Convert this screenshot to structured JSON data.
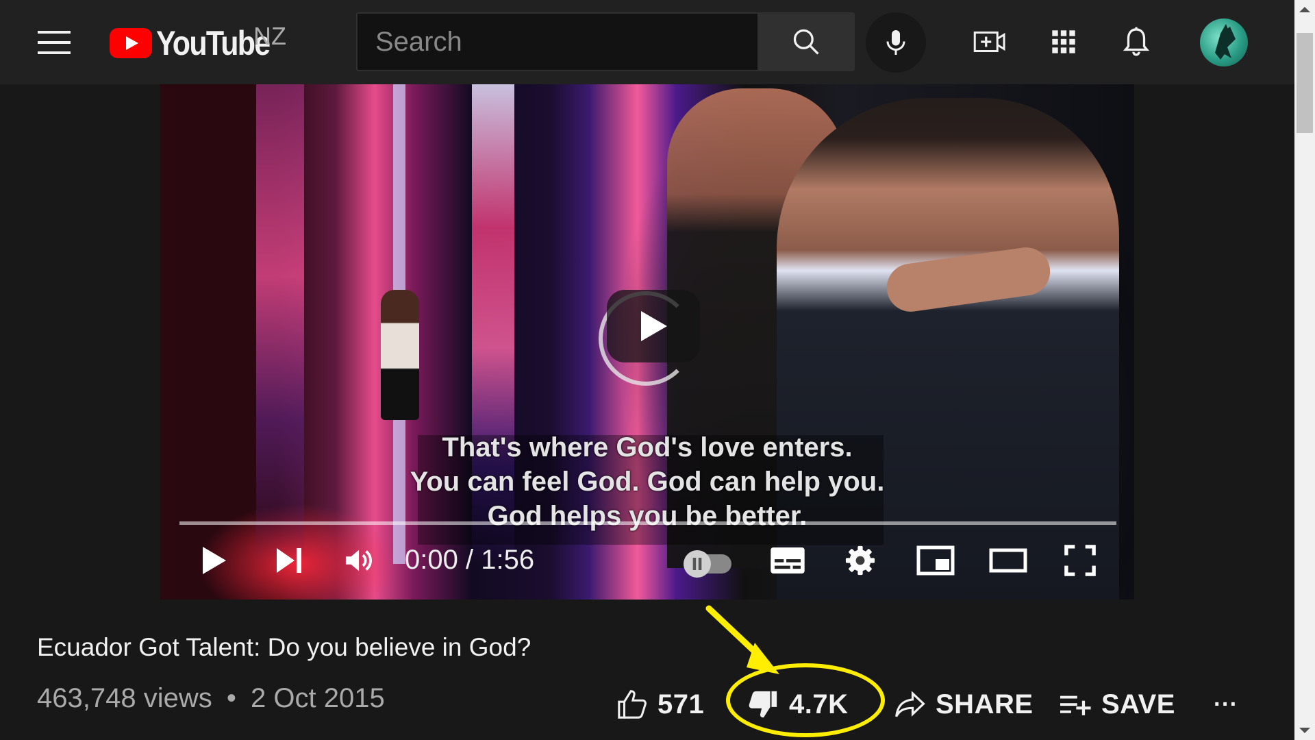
{
  "header": {
    "logo_text": "YouTube",
    "country_code": "NZ",
    "search_placeholder": "Search"
  },
  "icons": {
    "menu": "menu-icon",
    "search": "search-icon",
    "mic": "mic-icon",
    "create": "create-video-icon",
    "apps": "apps-grid-icon",
    "notifications": "bell-icon",
    "avatar": "avatar-icon"
  },
  "video": {
    "subtitles": [
      "That's where God's love enters.",
      "You can feel God. God can help you.",
      "God helps you be better."
    ],
    "time_current": "0:00",
    "time_separator": "/",
    "time_total": "1:56",
    "progress_fraction": 0.0
  },
  "details": {
    "title": "Ecuador Got Talent: Do you believe in God?",
    "views": "463,748 views",
    "separator": "•",
    "date": "2 Oct 2015",
    "like_count": "571",
    "dislike_count": "4.7K",
    "share_label": "SHARE",
    "save_label": "SAVE",
    "more_label": "···"
  },
  "annotation": {
    "color": "#ffee00",
    "target": "dislike-button"
  },
  "colors": {
    "background": "#181818",
    "header": "#212121",
    "brand_red": "#ff0000",
    "text": "#f1f1f1",
    "secondary_text": "#aaaaaa"
  }
}
